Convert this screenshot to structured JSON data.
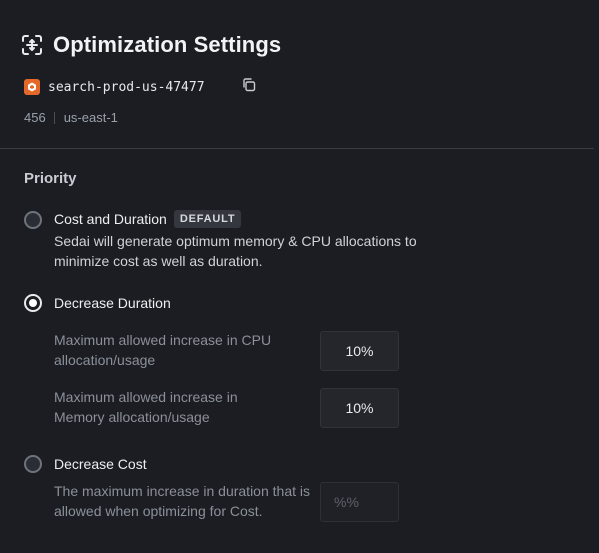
{
  "header": {
    "title": "Optimization Settings",
    "title_icon": "optimize-target-icon"
  },
  "resource": {
    "name": "search-prod-us-47477",
    "icon": "lambda-function-icon",
    "icon_color": "#e5682a",
    "account_id": "456",
    "region": "us-east-1"
  },
  "priority": {
    "section_title": "Priority",
    "options": [
      {
        "label": "Cost and Duration",
        "badge": "DEFAULT",
        "description": "Sedai will generate optimum memory & CPU allocations to minimize cost as well as duration.",
        "selected": false
      },
      {
        "label": "Decrease Duration",
        "selected": true,
        "fields": [
          {
            "label": "Maximum allowed increase in CPU allocation/usage",
            "value": "10%"
          },
          {
            "label": "Maximum allowed increase in Memory allocation/usage",
            "value": "10%"
          }
        ]
      },
      {
        "label": "Decrease Cost",
        "selected": false,
        "fields": [
          {
            "label": "The maximum increase in duration that is allowed when optimizing for Cost.",
            "placeholder": "%%",
            "disabled": true
          }
        ]
      }
    ]
  }
}
